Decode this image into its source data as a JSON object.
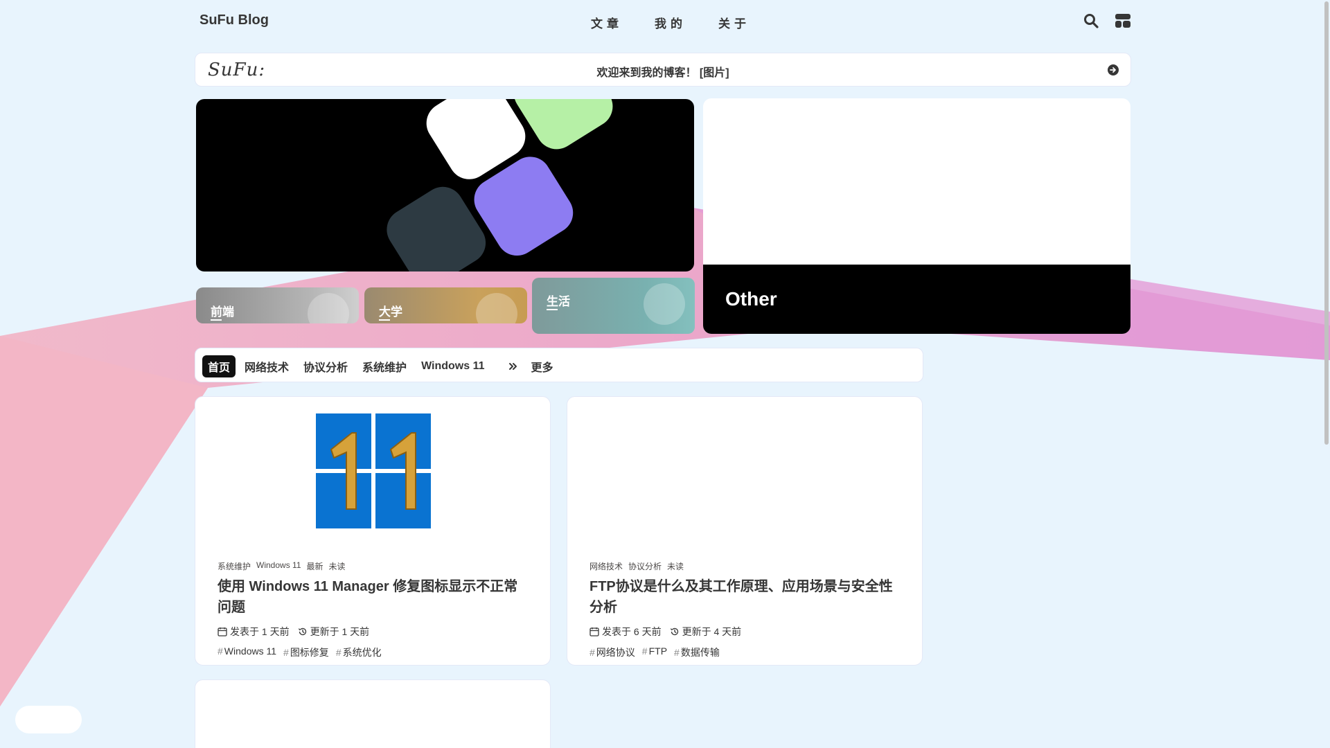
{
  "nav": {
    "brand": "SuFu Blog",
    "menu": [
      "文章",
      "我的",
      "关于"
    ],
    "icons": [
      "search-icon",
      "layout-icon"
    ]
  },
  "welcome": {
    "logo": "SuFu:",
    "message": "欢迎来到我的博客！ [图片]",
    "arrow_icon": "arrow-right-circle-icon"
  },
  "categories": {
    "front": "前端",
    "university": "大学",
    "life": "生活",
    "other": "Other"
  },
  "tabs": {
    "items": [
      "首页",
      "网络技术",
      "协议分析",
      "系统维护",
      "Windows 11"
    ],
    "active_index": 0,
    "more_icon": "double-chevron-right-icon",
    "more_label": "更多"
  },
  "posts": [
    {
      "cats": [
        "系统维护",
        "Windows 11",
        "最新",
        "未读"
      ],
      "title": "使用 Windows 11 Manager 修复图标显示不正常问题",
      "published": "发表于 1 天前",
      "updated": "更新于 1 天前",
      "tags": [
        "Windows 11",
        "图标修复",
        "系统优化"
      ]
    },
    {
      "cats": [
        "网络技术",
        "协议分析",
        "未读"
      ],
      "title": "FTP协议是什么及其工作原理、应用场景与安全性分析",
      "published": "发表于 6 天前",
      "updated": "更新于 4 天前",
      "tags": [
        "网络协议",
        "FTP",
        "数据传输"
      ]
    }
  ],
  "colors": {
    "background": "#e8f4fd",
    "accent_pink": "#f0a6c4",
    "accent_purple": "#d98bd3"
  }
}
